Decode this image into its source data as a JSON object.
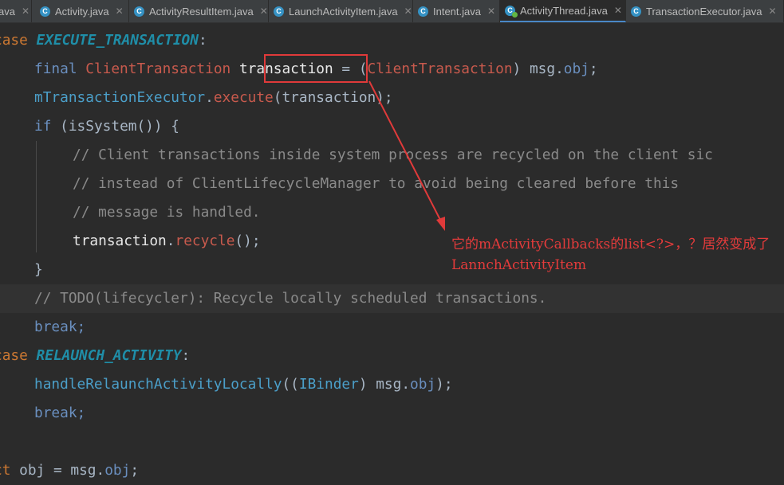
{
  "tabs": [
    {
      "label": "ava",
      "icon": "none",
      "active": false
    },
    {
      "label": "Activity.java",
      "icon": "class-icon",
      "active": false
    },
    {
      "label": "ActivityResultItem.java",
      "icon": "class-icon",
      "active": false
    },
    {
      "label": "LaunchActivityItem.java",
      "icon": "class-icon",
      "active": false
    },
    {
      "label": "Intent.java",
      "icon": "class-icon",
      "active": false
    },
    {
      "label": "ActivityThread.java",
      "icon": "class-icon",
      "active": true
    },
    {
      "label": "TransactionExecutor.java",
      "icon": "class-icon",
      "active": false
    }
  ],
  "code": {
    "l1": {
      "kw": "case ",
      "const": "EXECUTE_TRANSACTION",
      "rest": ":"
    },
    "l2": {
      "final": "final ",
      "type": "ClientTransaction",
      "sp": " ",
      "var": "transaction",
      "eq": " = (",
      "type2": "ClientTransaction",
      "mid": ") msg.",
      "field": "obj",
      "end": ";"
    },
    "l3": {
      "field": "mTransactionExecutor",
      "dot": ".",
      "call": "execute",
      "rest": "(transaction);"
    },
    "l4": {
      "kw": "if",
      "rest": " (isSystem()) {"
    },
    "l5": "// Client transactions inside system process are recycled on the client sic",
    "l6": "// instead of ClientLifecycleManager to avoid being cleared before this",
    "l7": "// message is handled.",
    "l8": {
      "var": "transaction",
      "dot": ".",
      "call": "recycle",
      "rest": "();"
    },
    "l9": "}",
    "l10": "// TODO(lifecycler): Recycle locally scheduled transactions.",
    "l11": "break;",
    "l12": {
      "kw": "case ",
      "const": "RELAUNCH_ACTIVITY",
      "rest": ":"
    },
    "l13": {
      "call": "handleRelaunchActivityLocally",
      "open": "((",
      "type": "IBinder",
      "mid": ") msg.",
      "field": "obj",
      "end": ");"
    },
    "l14": "break;",
    "l16": {
      "pre": "ct",
      "rest": " obj = msg.",
      "field": "obj",
      "end": ";"
    }
  },
  "annotation": {
    "text": "它的mActivityCallbacks的list<?>，？居然变成了LannchActivityItem",
    "color": "#e33b3b"
  },
  "colors": {
    "background": "#2b2b2b",
    "tabbar": "#3c3f41",
    "annotation_red": "#e03a3a"
  }
}
